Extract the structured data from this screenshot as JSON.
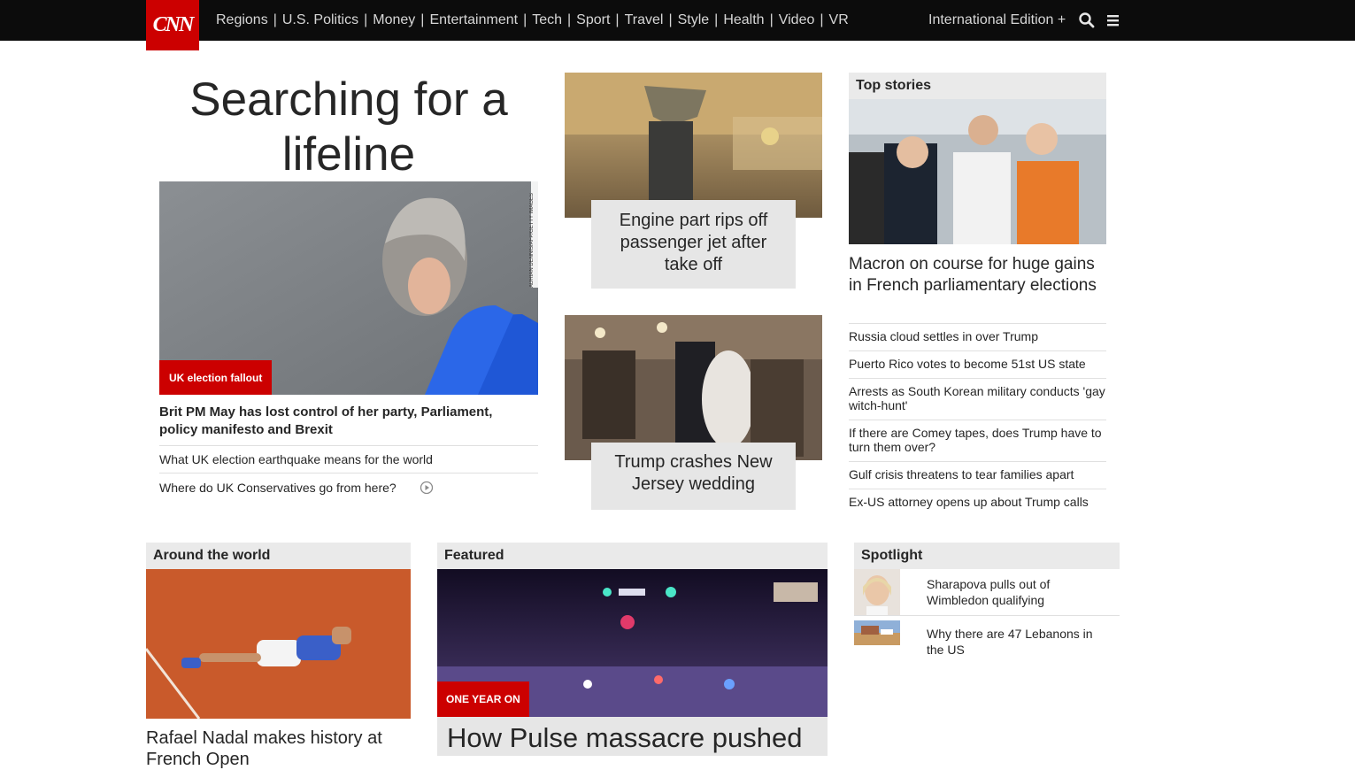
{
  "brand": {
    "logo_text": "CNN"
  },
  "nav": {
    "items": [
      "Regions",
      "U.S. Politics",
      "Money",
      "Entertainment",
      "Tech",
      "Sport",
      "Travel",
      "Style",
      "Health",
      "Video",
      "VR"
    ],
    "edition": "International Edition +"
  },
  "lead": {
    "headline": "Searching for a lifeline",
    "image_credit": "ADRIAN DENNIS/AFP/GETTY IMAGES",
    "kicker": "UK election fallout",
    "title": "Brit PM May has lost control of her party, Parliament, policy manifesto and Brexit",
    "links": [
      "What UK election earthquake means for the world",
      "Where do UK Conservatives go from here?"
    ]
  },
  "cards": [
    {
      "caption": "Engine part rips off passenger jet after take off"
    },
    {
      "caption": "Trump crashes New Jersey wedding"
    }
  ],
  "top_stories": {
    "heading": "Top stories",
    "main": "Macron on course for huge gains in French parliamentary elections",
    "items": [
      "Russia cloud settles in over Trump",
      "Puerto Rico votes to become 51st US state",
      "Arrests as South Korean military conducts 'gay witch-hunt'",
      "If there are Comey tapes, does Trump have to turn them over?",
      "Gulf crisis threatens to tear families apart",
      "Ex-US attorney opens up about Trump calls"
    ]
  },
  "around": {
    "heading": "Around the world",
    "title": "Rafael Nadal makes history at French Open"
  },
  "featured": {
    "heading": "Featured",
    "kicker": "ONE YEAR ON",
    "title": "How Pulse massacre pushed"
  },
  "spotlight": {
    "heading": "Spotlight",
    "items": [
      "Sharapova pulls out of Wimbledon qualifying",
      "Why there are 47 Lebanons in the US"
    ]
  },
  "colors": {
    "brand_red": "#cc0000",
    "nav_bg": "#0c0c0c",
    "caption_bg": "#e6e6e6"
  }
}
